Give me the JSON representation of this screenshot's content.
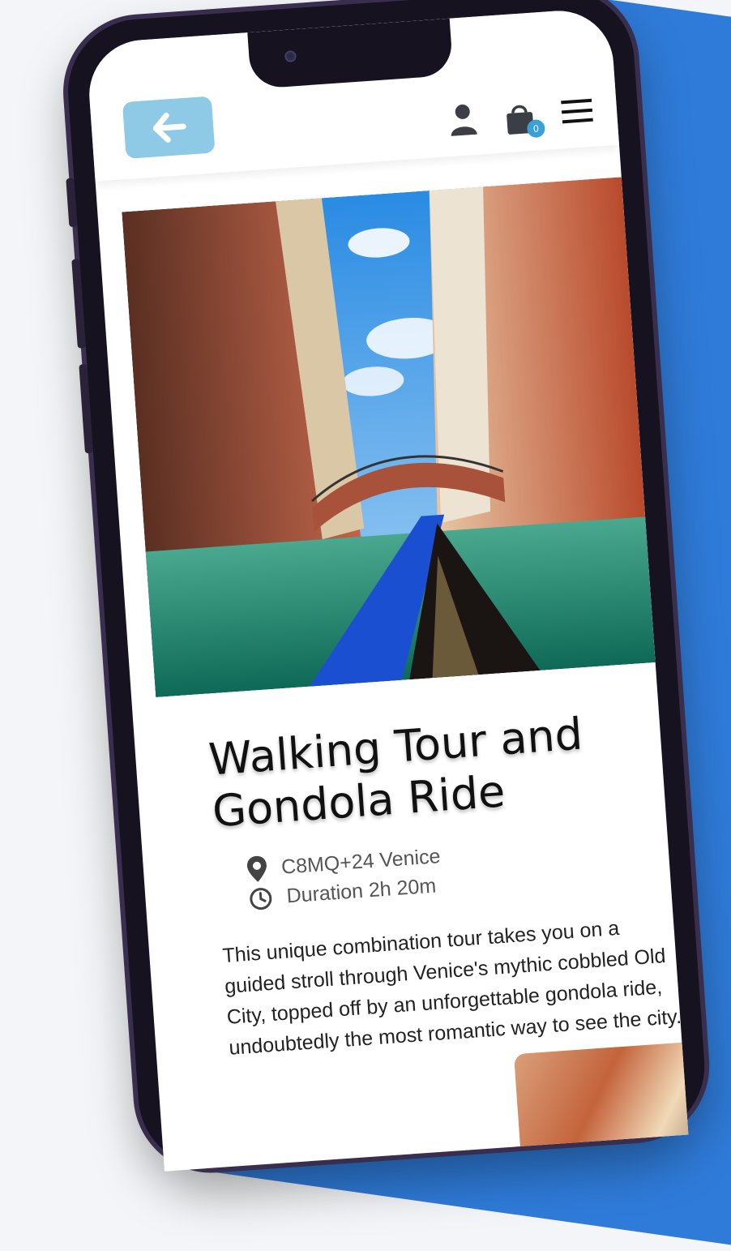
{
  "app": {
    "cart_count": "0"
  },
  "header": {
    "back_icon": "arrow-left-icon",
    "user_icon": "user-icon",
    "cart_icon": "shopping-bag-icon",
    "menu_icon": "hamburger-menu-icon"
  },
  "tour": {
    "title": "Walking Tour and Gondola Ride",
    "location": "C8MQ+24 Venice",
    "duration": "Duration 2h 20m",
    "description": "This unique combination tour takes you on a guided stroll through Venice's mythic cobbled Old City, topped off by an unforgettable gondola ride, undoubtedly the most romantic way to see the city."
  },
  "colors": {
    "accent_blue": "#2f7bd9",
    "back_button": "#8ec9e6",
    "badge": "#3aa0d8"
  }
}
